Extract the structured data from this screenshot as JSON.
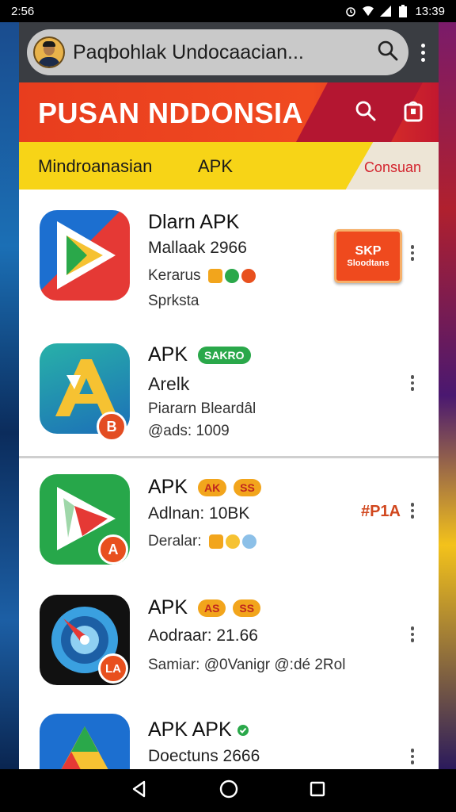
{
  "status_bar": {
    "time": "2:56",
    "clock": "13:39"
  },
  "browser": {
    "url_text": "Paqbohlak Undocaacian..."
  },
  "banner": {
    "title": "PUSAN NDDONSIA",
    "tab_left": "Mindroanasian",
    "tab_mid": "APK",
    "tab_right": "Consuan"
  },
  "apps": [
    {
      "title": "Dlarn APK",
      "line1": "Mallaak 2966",
      "line2": "Kerarus",
      "line3": "Sprksta",
      "sale_top": "SKP",
      "sale_bottom": "Sloodtans"
    },
    {
      "title": "APK",
      "pill": "SAKRO",
      "line1": "Arelk",
      "line2": "Piararn Bleardâl",
      "line3": "@ads: 1009",
      "badge": "B"
    },
    {
      "title": "APK",
      "pill1": "AK",
      "pill2": "SS",
      "line1": "Adlnan: 10BK",
      "line2": "Deralar:",
      "price": "#P1A",
      "badge": "A"
    },
    {
      "title": "APK",
      "pill1": "AS",
      "pill2": "SS",
      "line1": "Aodraar: 21.66",
      "line2": "Samiar: @0Vanigr @:dé 2Rol",
      "badge": "LA"
    },
    {
      "title": "APK APK",
      "line1": "Doectuns 2666"
    }
  ],
  "colors": {
    "brand_red": "#e83d1e",
    "brand_yellow": "#f7d417",
    "accent_green": "#2aa84a",
    "accent_orange": "#f2a51c"
  },
  "icons": [
    "search-icon",
    "more-vert-icon",
    "cart-icon",
    "back-icon",
    "home-icon",
    "recents-icon",
    "alarm-icon",
    "wifi-icon",
    "signal-icon",
    "battery-icon"
  ]
}
